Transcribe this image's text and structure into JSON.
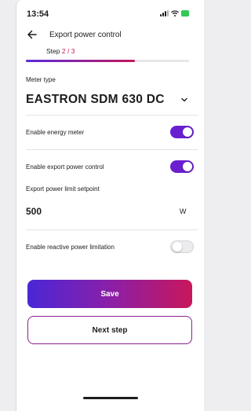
{
  "status": {
    "time": "13:54",
    "battery_color": "#34c759"
  },
  "header": {
    "title": "Export power control",
    "back_icon": "arrow-left"
  },
  "step": {
    "prefix": "Step ",
    "current": "2",
    "separator": " / ",
    "total": "3",
    "progress_fraction": 0.667
  },
  "meter": {
    "label": "Meter type",
    "value": "EASTRON SDM 630 DC",
    "dropdown_icon": "chevron-down"
  },
  "energy_meter": {
    "label": "Enable energy meter",
    "enabled": true
  },
  "export_control": {
    "label": "Enable export power control",
    "enabled": true
  },
  "export_limit": {
    "label": "Export power limit setpoint",
    "value": "500",
    "unit": "W"
  },
  "reactive": {
    "label": "Enable reactive power limitation",
    "enabled": false
  },
  "buttons": {
    "save_label": "Save",
    "next_label": "Next step"
  },
  "colors": {
    "accent_purple": "#6a1fd1",
    "accent_magenta": "#c2185b"
  }
}
